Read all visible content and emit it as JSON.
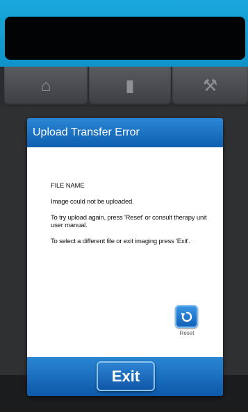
{
  "header_tabs": [
    {
      "icon": "home-icon",
      "glyph": "⌂"
    },
    {
      "icon": "document-icon",
      "glyph": "▮"
    },
    {
      "icon": "tools-icon",
      "glyph": "⚒"
    }
  ],
  "dialog": {
    "title": "Upload Transfer Error",
    "file_name": "FILE NAME",
    "message1": "Image could not be uploaded.",
    "message2": "To try upload again, press 'Reset' or consult therapy unit user manual.",
    "message3": "To select a different file or exit imaging press 'Exit'.",
    "reset_label": "Reset",
    "exit_label": "Exit",
    "reset_icon": "reset-icon"
  },
  "colors": {
    "accent_top": "#1aa7dd",
    "dialog_blue": "#1a6fc2",
    "background": "#2f3032"
  }
}
